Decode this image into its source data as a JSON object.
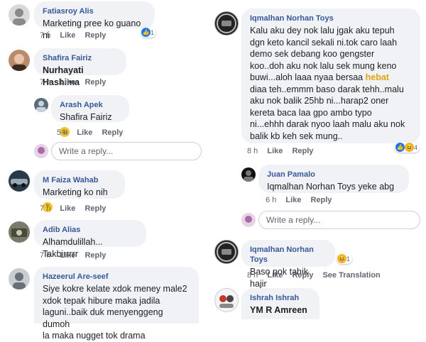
{
  "left": {
    "c1": {
      "name": "Fatiasroy Alis",
      "text": "Marketing pree ko guano ni",
      "time": "7 h",
      "like": "Like",
      "reply": "Reply",
      "react_count": "1"
    },
    "c2": {
      "name": "Shafira Fairiz",
      "tag": "Nurhayati Hashima",
      "time": "7 h",
      "like": "Like",
      "reply": "Reply"
    },
    "c3": {
      "name": "Arash Apek",
      "tag": "Shafira Fairiz",
      "time": "5 h",
      "like": "Like",
      "reply": "Reply"
    },
    "reply_input": {
      "placeholder": "Write a reply..."
    },
    "c4": {
      "name": "M Faiza Wahab",
      "text": "Marketing ko nih",
      "time": "7 h",
      "like": "Like",
      "reply": "Reply"
    },
    "c5": {
      "name": "Adib Alias",
      "text": "Alhamdulillah... Takbirrrrr",
      "time": "7 h",
      "like": "Like",
      "reply": "Reply"
    },
    "c6": {
      "name": "Hazeerul Are-seef",
      "text": "Siye kokre kelate xdok meney male2\nxdok tepak hibure maka jadila\nlaguni..baik duk menyenggeng dumoh\nla maka nugget tok drama"
    }
  },
  "right": {
    "c1": {
      "name": "Iqmalhan Norhan Toys",
      "text_a": "Kalu aku dey nok lalu jgak aku tepuh\ndgn keto kancil sekali ni.tok caro laah\ndemo sek debang koo gengster\nkoo..doh aku nok lalu sek mung keno\nbuwi...aloh laaa nyaa bersaa ",
      "highlight": "hebat",
      "text_b": "\ndiaa teh..emmm baso darak tehh..malu\naku nok balik 25hb ni...harap2 oner\nkereta baca laa gpo ambo typo\nni...ehhh darak nyoo laah malu aku nok\nbalik kb keh sek mung..",
      "time": "8 h",
      "like": "Like",
      "reply": "Reply",
      "react_count": "4"
    },
    "c2": {
      "name": "Juan Pamalo",
      "tag": "Iqmalhan Norhan Toys",
      "text": " yeke abg",
      "time": "6 h",
      "like": "Like",
      "reply": "Reply"
    },
    "reply_input": {
      "placeholder": "Write a reply..."
    },
    "c3": {
      "name": "Iqmalhan Norhan Toys",
      "text": "Baso pok tahik hajir",
      "time": "8 h",
      "like": "Like",
      "reply": "Reply",
      "translate": "See Translation",
      "react_count": "1"
    },
    "c4": {
      "name": "Ishrah Ishrah",
      "tag": "YM R Amreen"
    }
  },
  "colors": {
    "link": "#385898",
    "bubble": "#f0f2f5",
    "meta": "#606770",
    "highlight": "#e0a310"
  }
}
